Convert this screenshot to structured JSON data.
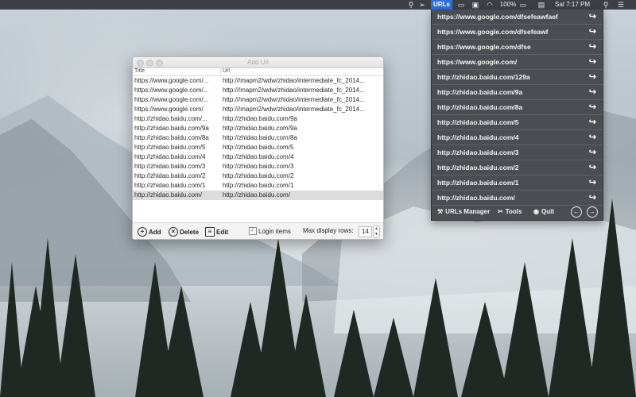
{
  "menubar": {
    "urls_label": "URLs",
    "battery": "100%",
    "clock": "Sat 7:17 PM",
    "icons": [
      "search-icon",
      "paperclip-icon",
      "airplay-icon",
      "display-icon",
      "wifi-icon",
      "battery-icon",
      "flag-icon",
      "spotlight-icon",
      "list-icon"
    ]
  },
  "menu": {
    "items": [
      "https://www.google.com/dfsefeawfaef",
      "https://www.google.com/dfsefeawf",
      "https://www.google.com/dfse",
      "https://www.google.com/",
      "http://zhidao.baidu.com/129a",
      "http://zhidao.baidu.com/9a",
      "http://zhidao.baidu.com/8a",
      "http://zhidao.baidu.com/5",
      "http://zhidao.baidu.com/4",
      "http://zhidao.baidu.com/3",
      "http://zhidao.baidu.com/2",
      "http://zhidao.baidu.com/1",
      "http://zhidao.baidu.com/"
    ],
    "urls_manager": "URLs Manager",
    "tools": "Tools",
    "quit": "Quit"
  },
  "window": {
    "title": "Add Url",
    "col_title": "Title",
    "col_url": "Url",
    "rows": [
      {
        "title": "https://www.google.com/...",
        "url": "http:///mapm2/wdw/zhidao/intermediate_fc_2014..."
      },
      {
        "title": "https://www.google.com/...",
        "url": "http:///mapm2/wdw/zhidao/intermediate_fc_2014..."
      },
      {
        "title": "https://www.google.com/...",
        "url": "http:///mapm2/wdw/zhidao/intermediate_fc_2014..."
      },
      {
        "title": "https://www.google.com/",
        "url": "http:///mapm2/wdw/zhidao/intermediate_fc_2014..."
      },
      {
        "title": "http://zhidao.baidu.com/...",
        "url": "http://zhidao.baidu.com/9a"
      },
      {
        "title": "http://zhidao.baidu.com/9a",
        "url": "http://zhidao.baidu.com/9a"
      },
      {
        "title": "http://zhidao.baidu.com/8a",
        "url": "http://zhidao.baidu.com/8a"
      },
      {
        "title": "http://zhidao.baidu.com/5",
        "url": "http://zhidao.baidu.com/5"
      },
      {
        "title": "http://zhidao.baidu.com/4",
        "url": "http://zhidao.baidu.com/4"
      },
      {
        "title": "http://zhidao.baidu.com/3",
        "url": "http://zhidao.baidu.com/3"
      },
      {
        "title": "http://zhidao.baidu.com/2",
        "url": "http://zhidao.baidu.com/2"
      },
      {
        "title": "http://zhidao.baidu.com/1",
        "url": "http://zhidao.baidu.com/1"
      },
      {
        "title": "http://zhidao.baidu.com/",
        "url": "http://zhidao.baidu.com/"
      }
    ],
    "add_label": "Add",
    "delete_label": "Delete",
    "edit_label": "Edit",
    "login_items_label": "Login items",
    "login_items_checked": true,
    "max_rows_label": "Max display rows:",
    "max_rows_value": "14"
  },
  "colors": {
    "menubar_bg": "#3c3f44",
    "menu_bg": "#4a4d52",
    "accent": "#2f6fd6"
  }
}
